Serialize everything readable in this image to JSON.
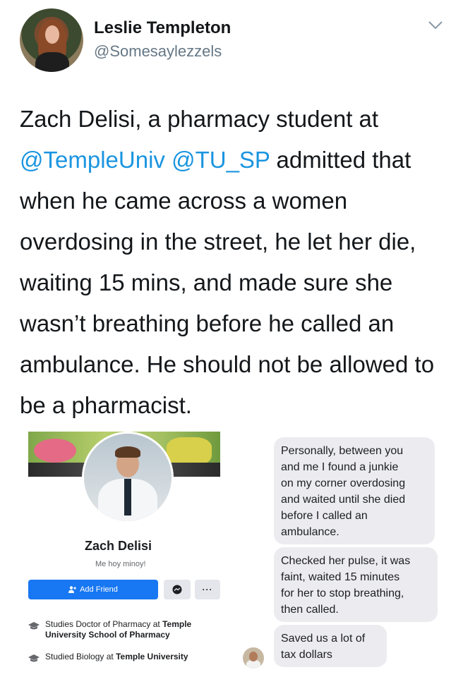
{
  "tweet": {
    "author_name": "Leslie Templeton",
    "author_handle": "@Somesaylezzels",
    "text_before": "Zach Delisi, a pharmacy student at ",
    "mention_1": "@TempleUniv",
    "text_between": " ",
    "mention_2": "@TU_SP",
    "text_after": " admitted that when he came across a women overdosing in the street, he let her die, waiting 15 mins, and made sure she wasn’t breathing before he called an ambulance. He should not be allowed to be a pharmacist.",
    "mention_color": "#1b95e0"
  },
  "facebook_profile": {
    "name": "Zach Delisi",
    "bio": "Me hoy minoy!",
    "add_friend_label": "Add Friend",
    "more_label": "···",
    "education": [
      {
        "prefix": "Studies Doctor of Pharmacy at ",
        "school": "Temple University School of Pharmacy"
      },
      {
        "prefix": "Studied Biology at ",
        "school": "Temple University"
      }
    ],
    "button_color": "#1877f2"
  },
  "messages": [
    "Personally, between you\nand me I found a junkie\non my corner overdosing\nand waited until she died\nbefore I called an\nambulance.",
    "Checked her pulse, it was\nfaint, waited 15 minutes\nfor her to stop breathing,\nthen called.",
    "Saved us a lot of\ntax dollars"
  ],
  "icons": [
    "chevron-down-icon",
    "add-person-icon",
    "messenger-icon",
    "graduation-cap-icon"
  ]
}
